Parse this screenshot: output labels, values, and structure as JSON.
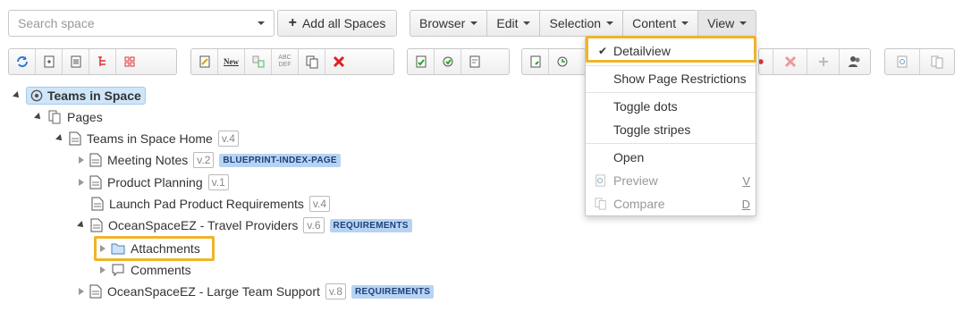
{
  "search": {
    "placeholder": "Search space"
  },
  "add_all_spaces": {
    "label": "Add all Spaces",
    "icon": "plus-icon"
  },
  "menubar": {
    "items": [
      {
        "label": "Browser"
      },
      {
        "label": "Edit"
      },
      {
        "label": "Selection"
      },
      {
        "label": "Content"
      },
      {
        "label": "View"
      }
    ]
  },
  "toolbar": {
    "groups": [
      [
        "refresh-icon",
        "add-page-icon",
        "page-list-icon",
        "tree-red-icon",
        "tree-grid-icon"
      ],
      [
        "edit-page-icon",
        "new-icon",
        "move-icon",
        "abc-def-icon",
        "copy-icon",
        "delete-red-icon"
      ],
      [
        "approve-icon",
        "approve-cycle-icon",
        "page-export-icon"
      ],
      [
        "page-add-icon",
        "page-refresh-icon"
      ],
      [
        "delete-gray-icon",
        "plus-gray-icon",
        "users-icon"
      ],
      [
        "preview-icon",
        "compare-icon"
      ]
    ],
    "new_text": "New",
    "abc_text": "ABC",
    "def_text": "DEF"
  },
  "tree": {
    "root": {
      "label": "Teams in Space"
    },
    "pages": {
      "label": "Pages"
    },
    "home": {
      "label": "Teams in Space Home",
      "version": "v.4"
    },
    "items": [
      {
        "label": "Meeting Notes",
        "version": "v.2",
        "badge": "BLUEPRINT-INDEX-PAGE"
      },
      {
        "label": "Product Planning",
        "version": "v.1"
      },
      {
        "label": "Launch Pad Product Requirements",
        "version": "v.4"
      },
      {
        "label": "OceanSpaceEZ - Travel Providers",
        "version": "v.6",
        "badge": "REQUIREMENTS"
      },
      {
        "label": "Attachments"
      },
      {
        "label": "Comments"
      },
      {
        "label": "OceanSpaceEZ - Large Team Support",
        "version": "v.8",
        "badge": "REQUIREMENTS"
      }
    ]
  },
  "view_menu": {
    "items": [
      {
        "label": "Detailview",
        "checked": true
      },
      {
        "label": "Show Page Restrictions"
      },
      {
        "label": "Toggle dots"
      },
      {
        "label": "Toggle stripes"
      },
      {
        "label": "Open"
      },
      {
        "label": "Preview",
        "shortcut": "V",
        "disabled": true
      },
      {
        "label": "Compare",
        "shortcut": "D",
        "disabled": true
      }
    ]
  },
  "colors": {
    "highlight": "#f0b429",
    "badge_bg": "#b7d3f3",
    "root_bg": "#cfe6f9"
  }
}
